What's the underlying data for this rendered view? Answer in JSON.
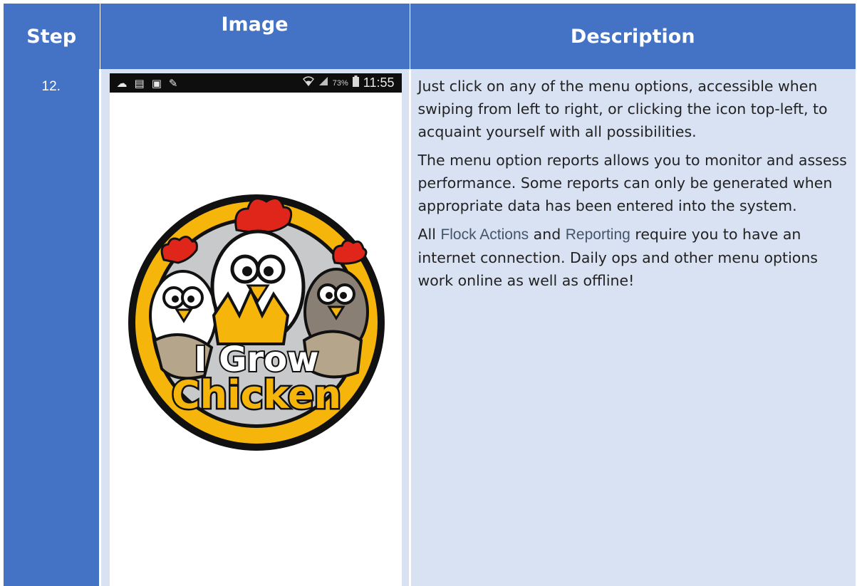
{
  "table": {
    "headers": {
      "step": "Step",
      "image": "Image",
      "description": "Description"
    },
    "colors": {
      "header_bg": "#4472c4",
      "cell_bg": "#d9e2f3",
      "link": "#44546a"
    }
  },
  "row": {
    "step": "12.",
    "phone": {
      "status_icons": [
        "cloud-icon",
        "message-icon",
        "clipboard-icon",
        "pencil-icon"
      ],
      "battery_pct": "73%",
      "time": "11:55",
      "logo_text_line1": "I Grow",
      "logo_text_line2": "Chicken"
    },
    "description": {
      "p1": "Just click on any of the menu options, accessible when swiping from left to right, or clicking the icon top-left, to acquaint yourself with all possibilities.",
      "p2": "The menu option reports allows you to monitor and assess performance. Some reports can only be generated when appropriate data has been entered into the system.",
      "p3_pre": "All ",
      "p3_link1": "Flock Actions",
      "p3_mid": " and ",
      "p3_link2": "Reporting",
      "p3_post": " require you to have an internet connection. Daily ops and other menu options work online as well as offline!"
    }
  }
}
